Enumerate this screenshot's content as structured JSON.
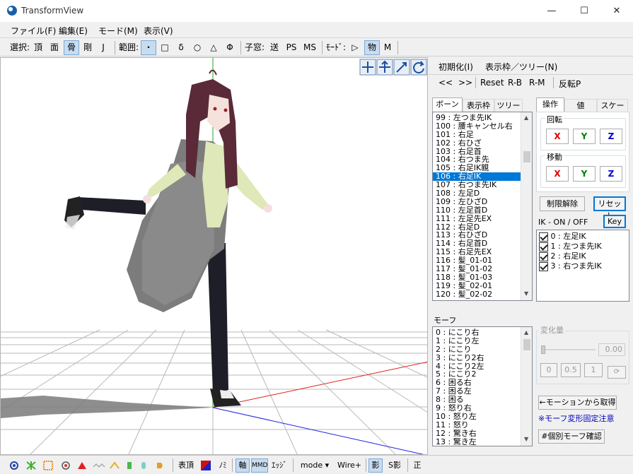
{
  "window": {
    "title": "TransformView",
    "min": "—",
    "max": "☐",
    "close": "✕"
  },
  "menu": [
    "ファイル(F)",
    "編集(E)",
    "モード(M)",
    "表示(V)"
  ],
  "toolbar": {
    "select_label": "選択:",
    "select_items": [
      "頂",
      "面",
      "骨",
      "剛",
      "J"
    ],
    "select_active": "骨",
    "range_label": "範囲:",
    "range_items": [
      "・",
      "□",
      "δ",
      "○",
      "△",
      "Φ"
    ],
    "child_label": "子窓:",
    "child_items": [
      "送",
      "PS",
      "MS"
    ],
    "mode_label": "ﾓｰﾄﾞ:",
    "mode_items": [
      "▷",
      "物",
      "M"
    ]
  },
  "right": {
    "top_buttons": {
      "init": "初期化(I)",
      "display": "表示枠／ツリー(N)"
    },
    "nav": [
      "<<",
      ">>",
      "Reset",
      "R-B",
      "R-M",
      "反転P"
    ],
    "bone_tabs": [
      "ボーン",
      "表示枠",
      "ツリー"
    ],
    "bones": [
      "99 : 左つま先IK",
      "100 : 腰キャンセル右",
      "101 : 右足",
      "102 : 右ひざ",
      "103 : 右足首",
      "104 : 右つま先",
      "105 : 右足IK親",
      "106 : 右足IK",
      "107 : 右つま先IK",
      "108 : 左足D",
      "109 : 左ひざD",
      "110 : 左足首D",
      "111 : 左足先EX",
      "112 : 右足D",
      "113 : 右ひざD",
      "114 : 右足首D",
      "115 : 右足先EX",
      "116 : 髪_01-01",
      "117 : 髪_01-02",
      "118 : 髪_01-03",
      "119 : 髪_02-01",
      "120 : 髪_02-02"
    ],
    "bone_selected": 7,
    "op_tabs": [
      "操作",
      "値",
      "スケール"
    ],
    "rotate_label": "回転",
    "move_label": "移動",
    "axes": [
      "X",
      "Y",
      "Z"
    ],
    "axis_colors": {
      "X": "#e00000",
      "Y": "#008000",
      "Z": "#0000d0"
    },
    "unlock": "制限解除",
    "reset": "リセット",
    "ik_label": "IK - ON / OFF",
    "key": "Key",
    "ik_items": [
      "0 : 左足IK",
      "1 : 左つま先IK",
      "2 : 右足IK",
      "3 : 右つま先IK"
    ],
    "morph_label": "モーフ",
    "morphs": [
      "0 : にこり右",
      "1 : にこり左",
      "2 : にこり",
      "3 : にこり2右",
      "4 : にこり2左",
      "5 : にこり2",
      "6 : 困る右",
      "7 : 困る左",
      "8 : 困る",
      "9 : 怒り右",
      "10 : 怒り左",
      "11 : 怒り",
      "12 : 驚き右",
      "13 : 驚き左"
    ],
    "change_label": "変化量",
    "change_value": "0.00",
    "preset_buttons": [
      "0",
      "0.5",
      "1",
      "⟳"
    ],
    "from_motion": "←モーションから取得",
    "morph_note": "※モーフ変形固定注意",
    "morph_check": "#個別モーフ確認"
  },
  "status": {
    "labels": [
      "表頂",
      "ﾉﾐ",
      "軸",
      "MMD",
      "ｴｯｼﾞ",
      "mode ▾",
      "Wire+",
      "影",
      "S影",
      "正"
    ]
  }
}
